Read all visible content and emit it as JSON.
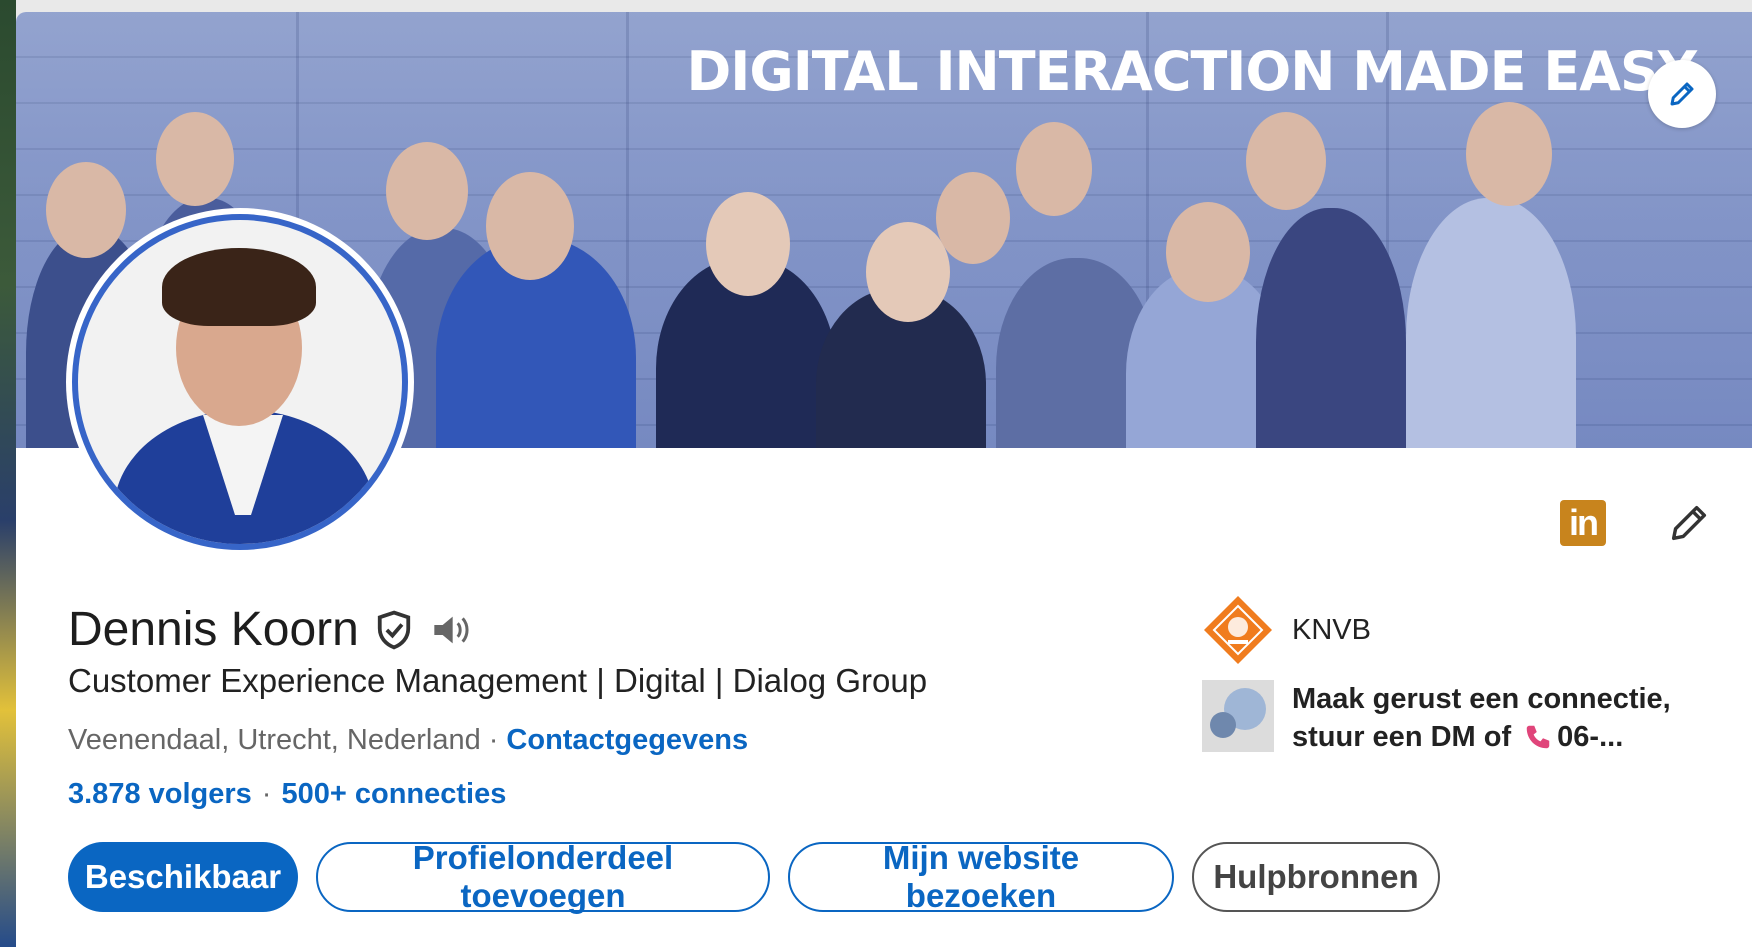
{
  "banner": {
    "title": "DIGITAL INTERACTION MADE EASY"
  },
  "profile": {
    "name": "Dennis Koorn",
    "headline": "Customer Experience Management | Digital | Dialog Group",
    "location": "Veenendaal, Utrecht, Nederland",
    "separator": "·",
    "contact_link": "Contactgegevens",
    "followers": "3.878 volgers",
    "stats_separator": "·",
    "connections": "500+ connecties"
  },
  "buttons": {
    "available": "Beschikbaar",
    "add_section": "Profielonderdeel toevoegen",
    "visit_website": "Mijn website bezoeken",
    "resources": "Hulpbronnen"
  },
  "sidebar": {
    "organization": "KNVB",
    "tagline_line1": "Maak gerust een connectie,",
    "tagline_line2_prefix": "stuur een DM of ",
    "tagline_line2_suffix": "06-..."
  },
  "icons": {
    "linkedin_label": "in"
  },
  "colors": {
    "primary": "#0a66c2",
    "banner": "#7b8ec4",
    "avatar_ring": "#3765c8",
    "knvb_orange": "#f07c1e",
    "linkedin_gold": "#c8841d",
    "phone_pink": "#e0457a"
  }
}
